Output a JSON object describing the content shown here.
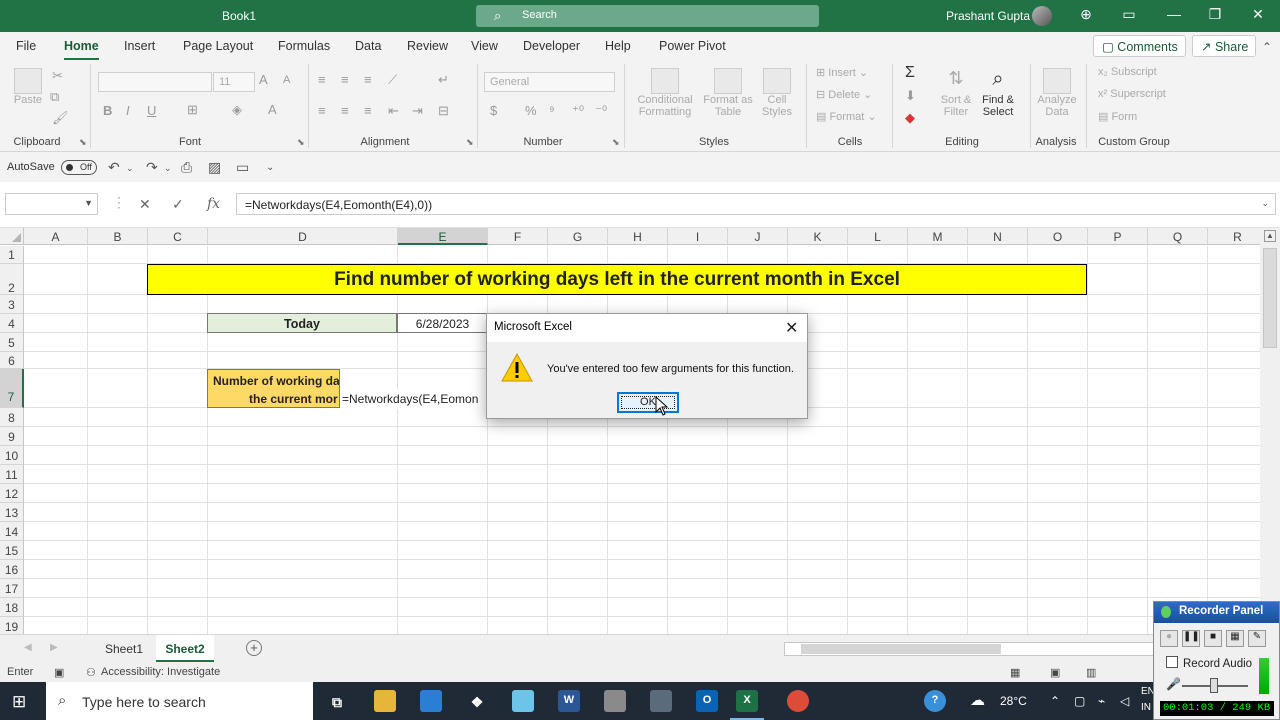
{
  "window": {
    "title": "Book1",
    "search_placeholder": "Search",
    "user": "Prashant Gupta"
  },
  "tabs": [
    "File",
    "Home",
    "Insert",
    "Page Layout",
    "Formulas",
    "Data",
    "Review",
    "View",
    "Developer",
    "Help",
    "Power Pivot"
  ],
  "active_tab": "Home",
  "header_buttons": {
    "comments": "Comments",
    "share": "Share"
  },
  "ribbon": {
    "clipboard": {
      "label": "Clipboard",
      "paste": "Paste"
    },
    "font": {
      "label": "Font",
      "font_name": "",
      "font_size": "11"
    },
    "alignment": {
      "label": "Alignment"
    },
    "number": {
      "label": "Number",
      "format": "General"
    },
    "styles": {
      "label": "Styles",
      "conditional": "Conditional",
      "conditional2": "Formatting",
      "format_as": "Format as",
      "format_as2": "Table",
      "cell": "Cell",
      "cell2": "Styles"
    },
    "cells": {
      "label": "Cells",
      "insert": "Insert",
      "delete": "Delete",
      "format": "Format"
    },
    "editing": {
      "label": "Editing",
      "sort": "Sort &",
      "sort2": "Filter",
      "find": "Find &",
      "find2": "Select"
    },
    "analysis": {
      "label": "Analysis",
      "analyze": "Analyze",
      "analyze2": "Data"
    },
    "custom": {
      "label": "Custom Group",
      "subscript": "Subscript",
      "superscript": "Superscript",
      "form": "Form"
    }
  },
  "qat": {
    "autosave": "AutoSave",
    "toggle": "Off"
  },
  "formula_bar": {
    "name_box": "",
    "formula": "=Networkdays(E4,Eomonth(E4),0))"
  },
  "columns": [
    "A",
    "B",
    "C",
    "D",
    "E",
    "F",
    "G",
    "H",
    "I",
    "J",
    "K",
    "L",
    "M",
    "N",
    "O",
    "P",
    "Q",
    "R"
  ],
  "selected_column": "E",
  "rows": [
    "1",
    "2",
    "3",
    "4",
    "5",
    "6",
    "7",
    "8",
    "9",
    "10",
    "11",
    "12",
    "13",
    "14",
    "15",
    "16",
    "17",
    "18",
    "19"
  ],
  "selected_row": "7",
  "cells": {
    "title": "Find number of working days left in the current month in Excel",
    "today_label": "Today",
    "today_value": "6/28/2023",
    "wd_label_line1": "Number of working da",
    "wd_label_line2": "the current mor",
    "editing": "=Networkdays(E4,Eomon"
  },
  "dialog": {
    "title": "Microsoft Excel",
    "message": "You've entered too few arguments for this function.",
    "ok": "OK"
  },
  "sheets": [
    "Sheet1",
    "Sheet2"
  ],
  "active_sheet": "Sheet2",
  "status": {
    "mode": "Enter",
    "accessibility": "Accessibility: Investigate"
  },
  "taskbar": {
    "search_placeholder": "Type here to search",
    "temperature": "28°C",
    "lang": "EN",
    "lang2": "IN"
  },
  "recorder": {
    "title": "Recorder Panel",
    "record_audio": "Record Audio",
    "time": "00:01:03 / 249 KB"
  },
  "colors": {
    "excel_green": "#217346",
    "title_fill": "#ffff00",
    "today_fill": "#e2efda",
    "wd_fill": "#ffd966"
  }
}
